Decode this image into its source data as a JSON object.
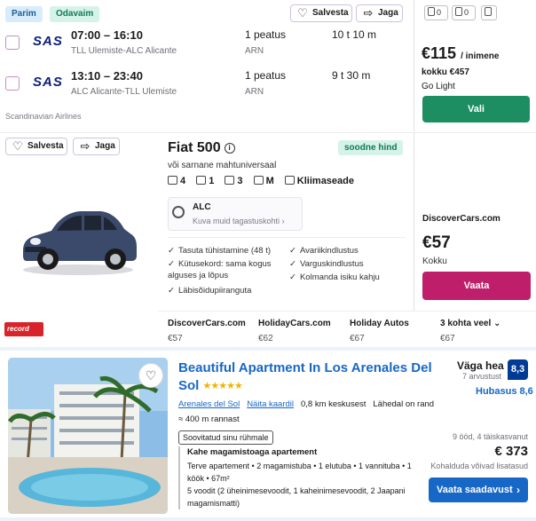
{
  "flight": {
    "tags": [
      "Parim",
      "Odavaim"
    ],
    "save_label": "Salvesta",
    "share_label": "Jaga",
    "legs": [
      {
        "airline_logo": "SAS",
        "times": "07:00 – 16:10",
        "route": "TLL Ulemiste-ALC Alicante",
        "stops": "1 peatus",
        "via": "ARN",
        "duration": "10 t 10 m"
      },
      {
        "airline_logo": "SAS",
        "times": "13:10 – 23:40",
        "route": "ALC Alicante-TLL Ulemiste",
        "stops": "1 peatus",
        "via": "ARN",
        "duration": "9 t 30 m"
      }
    ],
    "carrier": "Scandinavian Airlines",
    "bags": [
      "0",
      "0"
    ],
    "price": "€115",
    "price_unit": "/ inimene",
    "total": "kokku €457",
    "fare": "Go Light",
    "cta": "Vali",
    "colors": {
      "cta": "#1d8e62"
    }
  },
  "car": {
    "save_label": "Salvesta",
    "share_label": "Jaga",
    "title": "Fiat 500",
    "badge": "soodne hind",
    "subtitle": "või sarnane mahtuniversaal",
    "specs": {
      "seats": "4",
      "bags_large": "1",
      "doors": "3",
      "transmission": "M",
      "ac": "Kliimaseade"
    },
    "location_code": "ALC",
    "location_link": "Kuva muid tagastuskohti",
    "features_left": [
      "Tasuta tühistamine (48 t)",
      "Kütusekord: sama kogus alguses ja lõpus",
      "Läbisõidupiiranguta"
    ],
    "features_right": [
      "Avariikindlustus",
      "Varguskindlustus",
      "Kolmanda isiku kahju"
    ],
    "provider": "DiscoverCars.com",
    "price": "€57",
    "price_note": "Kokku",
    "cta": "Vaata",
    "agency_logo": "record",
    "other_providers": [
      {
        "name": "DiscoverCars.com",
        "price": "€57"
      },
      {
        "name": "HolidayCars.com",
        "price": "€62"
      },
      {
        "name": "Holiday Autos",
        "price": "€67"
      },
      {
        "name": "3 kohta veel",
        "price": "€67"
      }
    ],
    "colors": {
      "cta": "#bf1f6a"
    }
  },
  "hotel": {
    "title": "Beautiful Apartment In Los Arenales Del Sol",
    "stars": "★★★★★",
    "area_link": "Arenales del Sol",
    "map_link": "Näita kaardil",
    "distance": "0,8 km keskusest",
    "beach_near": "Lähedal on rand",
    "beach_distance": "400 m rannast",
    "group_badge": "Soovitatud sinu rühmale",
    "room_title": "Kahe magamistoaga apartement",
    "room_details": "Terve apartement • 2 magamistuba • 1 elutuba • 1 vannituba • 1 köök • 67m²",
    "beds": "5 voodit (2 üheinimesevoodit, 1 kaheinimesevoodit, 2 Jaapani magamismatti)",
    "rating_word": "Väga hea",
    "rating_count": "7 arvustust",
    "score": "8,3",
    "sub_rating": "Hubasus 8,6",
    "stay": "9 ööd, 4 täiskasvanut",
    "price": "€ 373",
    "tax_note": "Kohalduda võivad lisatasud",
    "cta": "Vaata saadavust",
    "colors": {
      "title": "#1767c7",
      "score": "#003b95",
      "cta": "#1767c7"
    }
  }
}
